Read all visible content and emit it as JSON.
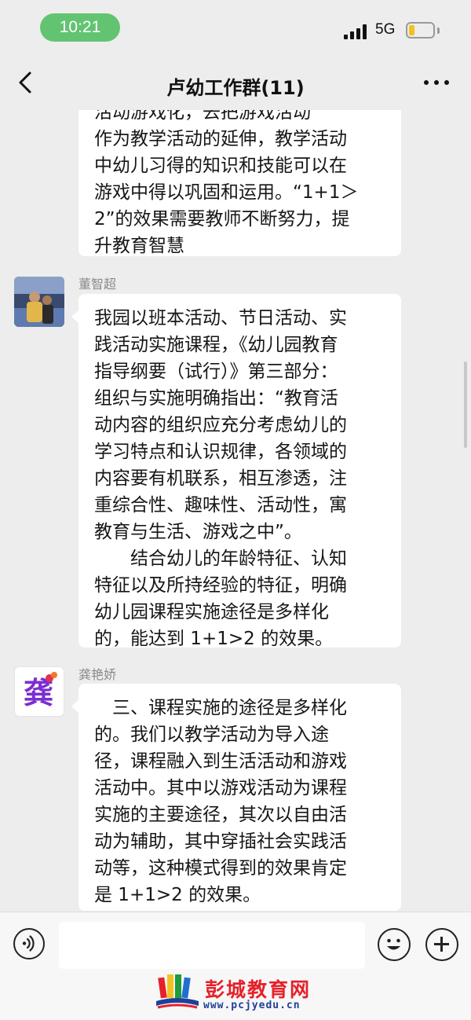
{
  "status_bar": {
    "time": "10:21",
    "network": "5G",
    "signal_icon": "cellular-signal-icon",
    "battery_icon": "battery-low-icon",
    "battery_level": 0.2,
    "battery_color": "#f4c220",
    "time_pill_color": "#62c471"
  },
  "nav": {
    "title": "卢幼工作群(11)",
    "back_icon": "chevron-left-icon",
    "more_icon": "more-horizontal-icon"
  },
  "messages": [
    {
      "sender": "",
      "lines": [
        "活动游戏化，去把游戏活动",
        "作为教学活动的延伸，教学活动",
        "中幼儿习得的知识和技能可以在",
        "游戏中得以巩固和运用。“1+1＞",
        "2”的效果需要教师不断努力，提",
        "升教育智慧"
      ]
    },
    {
      "sender": "董智超",
      "lines": [
        "我园以班本活动、节日活动、实",
        "践活动实施课程，《幼儿园教育",
        "指导纲要（试行）》第三部分：",
        "组织与实施明确指出：“教育活",
        "动内容的组织应充分考虑幼儿的",
        "学习特点和认识规律，各领域的",
        "内容要有机联系，相互渗透，注",
        "重综合性、趣味性、活动性，寓",
        "教育与生活、游戏之中”。",
        "　　结合幼儿的年龄特征、认知",
        "特征以及所持经验的特征，明确",
        "幼儿园课程实施途径是多样化",
        "的，能达到 1+1>2 的效果。"
      ]
    },
    {
      "sender": "龚艳娇",
      "avatar_text": "龚",
      "lines": [
        "　三、课程实施的途径是多样化",
        "的。我们以教学活动为导入途",
        "径，课程融入到生活活动和游戏",
        "活动中。其中以游戏活动为课程",
        "实施的主要途径，其次以自由活",
        "动为辅助，其中穿插社会实践活",
        "动等，这种模式得到的效果肯定",
        "是 1+1>2 的效果。"
      ]
    }
  ],
  "input_bar": {
    "placeholder": "",
    "voice_icon": "voice-input-icon",
    "emoji_icon": "emoji-icon",
    "plus_icon": "plus-icon"
  },
  "watermark": {
    "title": "彭城教育网",
    "url": "www.pcjyedu.cn"
  }
}
